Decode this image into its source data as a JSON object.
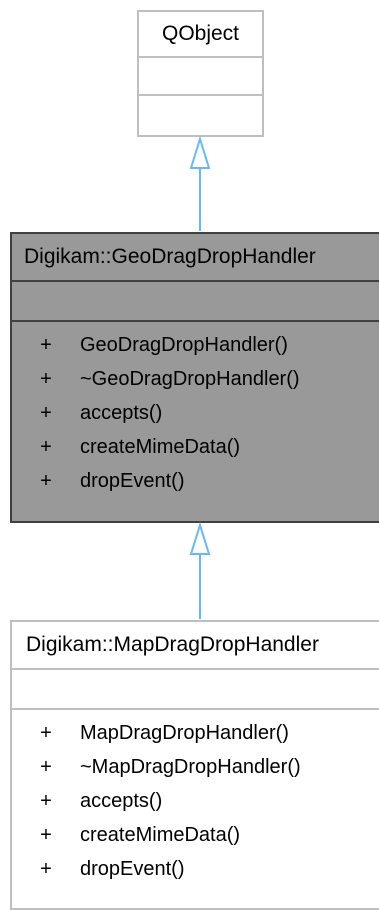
{
  "colors": {
    "border_light": "#bfbfbf",
    "border_dark": "#404040",
    "highlight_fill": "#999999",
    "arrow": "#63b8ff"
  },
  "classes": [
    {
      "id": "qobject",
      "title": "QObject",
      "attributes": [],
      "methods": []
    },
    {
      "id": "geo",
      "title": "Digikam::GeoDragDropHandler",
      "highlighted": true,
      "attributes": [],
      "methods": [
        {
          "visibility": "+",
          "name": "GeoDragDropHandler()"
        },
        {
          "visibility": "+",
          "name": "~GeoDragDropHandler()"
        },
        {
          "visibility": "+",
          "name": "accepts()"
        },
        {
          "visibility": "+",
          "name": "createMimeData()"
        },
        {
          "visibility": "+",
          "name": "dropEvent()"
        }
      ]
    },
    {
      "id": "map",
      "title": "Digikam::MapDragDropHandler",
      "attributes": [],
      "methods": [
        {
          "visibility": "+",
          "name": "MapDragDropHandler()"
        },
        {
          "visibility": "+",
          "name": "~MapDragDropHandler()"
        },
        {
          "visibility": "+",
          "name": "accepts()"
        },
        {
          "visibility": "+",
          "name": "createMimeData()"
        },
        {
          "visibility": "+",
          "name": "dropEvent()"
        }
      ]
    }
  ],
  "edges": [
    {
      "from": "geo",
      "to": "qobject",
      "type": "inheritance"
    },
    {
      "from": "map",
      "to": "geo",
      "type": "inheritance"
    }
  ]
}
